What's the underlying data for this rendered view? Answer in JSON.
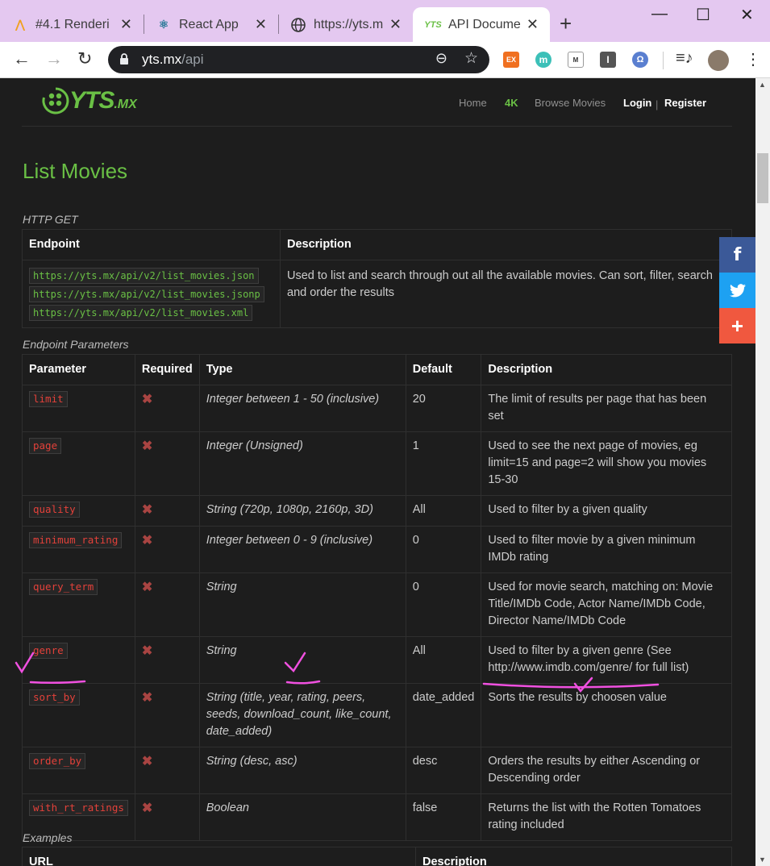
{
  "browser": {
    "tabs": [
      {
        "title": "#4.1 Renderi",
        "icon": "codelab-icon"
      },
      {
        "title": "React App",
        "icon": "react-icon"
      },
      {
        "title": "https://yts.m",
        "icon": "globe-icon"
      },
      {
        "title": "API Docume",
        "icon": "yts-icon"
      }
    ],
    "url_host": "yts.mx",
    "url_path": "/api",
    "extensions": [
      "EX",
      "m",
      "M",
      "I",
      "Ω"
    ]
  },
  "site": {
    "logo_main": "YTS",
    "logo_suffix": ".MX",
    "nav": {
      "home": "Home",
      "fourk": "4K",
      "browse": "Browse Movies",
      "login": "Login",
      "separator": "|",
      "register": "Register"
    }
  },
  "section": {
    "title": "List Movies",
    "method": "HTTP GET",
    "endpoint_header": {
      "endpoint": "Endpoint",
      "description": "Description"
    },
    "endpoints": [
      "https://yts.mx/api/v2/list_movies.json",
      "https://yts.mx/api/v2/list_movies.jsonp",
      "https://yts.mx/api/v2/list_movies.xml"
    ],
    "endpoint_description": "Used to list and search through out all the available movies. Can sort, filter, search and order the results",
    "params_caption": "Endpoint Parameters",
    "params_header": {
      "parameter": "Parameter",
      "required": "Required",
      "type": "Type",
      "default": "Default",
      "description": "Description"
    },
    "params": [
      {
        "name": "limit",
        "required": "✖",
        "type": "Integer between 1 - 50 (inclusive)",
        "default": "20",
        "description": "The limit of results per page that has been set"
      },
      {
        "name": "page",
        "required": "✖",
        "type": "Integer (Unsigned)",
        "default": "1",
        "description": "Used to see the next page of movies, eg limit=15 and page=2 will show you movies 15-30"
      },
      {
        "name": "quality",
        "required": "✖",
        "type": "String (720p, 1080p, 2160p, 3D)",
        "default": "All",
        "description": "Used to filter by a given quality"
      },
      {
        "name": "minimum_rating",
        "required": "✖",
        "type": "Integer between 0 - 9 (inclusive)",
        "default": "0",
        "description": "Used to filter movie by a given minimum IMDb rating"
      },
      {
        "name": "query_term",
        "required": "✖",
        "type": "String",
        "default": "0",
        "description": "Used for movie search, matching on: Movie Title/IMDb Code, Actor Name/IMDb Code, Director Name/IMDb Code"
      },
      {
        "name": "genre",
        "required": "✖",
        "type": "String",
        "default": "All",
        "description": "Used to filter by a given genre (See http://www.imdb.com/genre/ for full list)"
      },
      {
        "name": "sort_by",
        "required": "✖",
        "type": "String (title, year, rating, peers, seeds, download_count, like_count, date_added)",
        "default": "date_added",
        "description": "Sorts the results by choosen value"
      },
      {
        "name": "order_by",
        "required": "✖",
        "type": "String (desc, asc)",
        "default": "desc",
        "description": "Orders the results by either Ascending or Descending order"
      },
      {
        "name": "with_rt_ratings",
        "required": "✖",
        "type": "Boolean",
        "default": "false",
        "description": "Returns the list with the Rotten Tomatoes rating included"
      }
    ],
    "examples_caption": "Examples",
    "examples_header": {
      "url": "URL",
      "description": "Description"
    }
  },
  "social": [
    {
      "icon": "facebook-icon",
      "glyph": "f",
      "color": "#3b5998"
    },
    {
      "icon": "twitter-icon",
      "glyph": "🐦",
      "color": "#1da1f2"
    },
    {
      "icon": "share-plus-icon",
      "glyph": "+",
      "color": "#f0583f"
    }
  ],
  "colors": {
    "accent": "#6ac045",
    "param_red": "#e3413a",
    "annotation": "#f050e0",
    "background": "#1d1d1d"
  }
}
